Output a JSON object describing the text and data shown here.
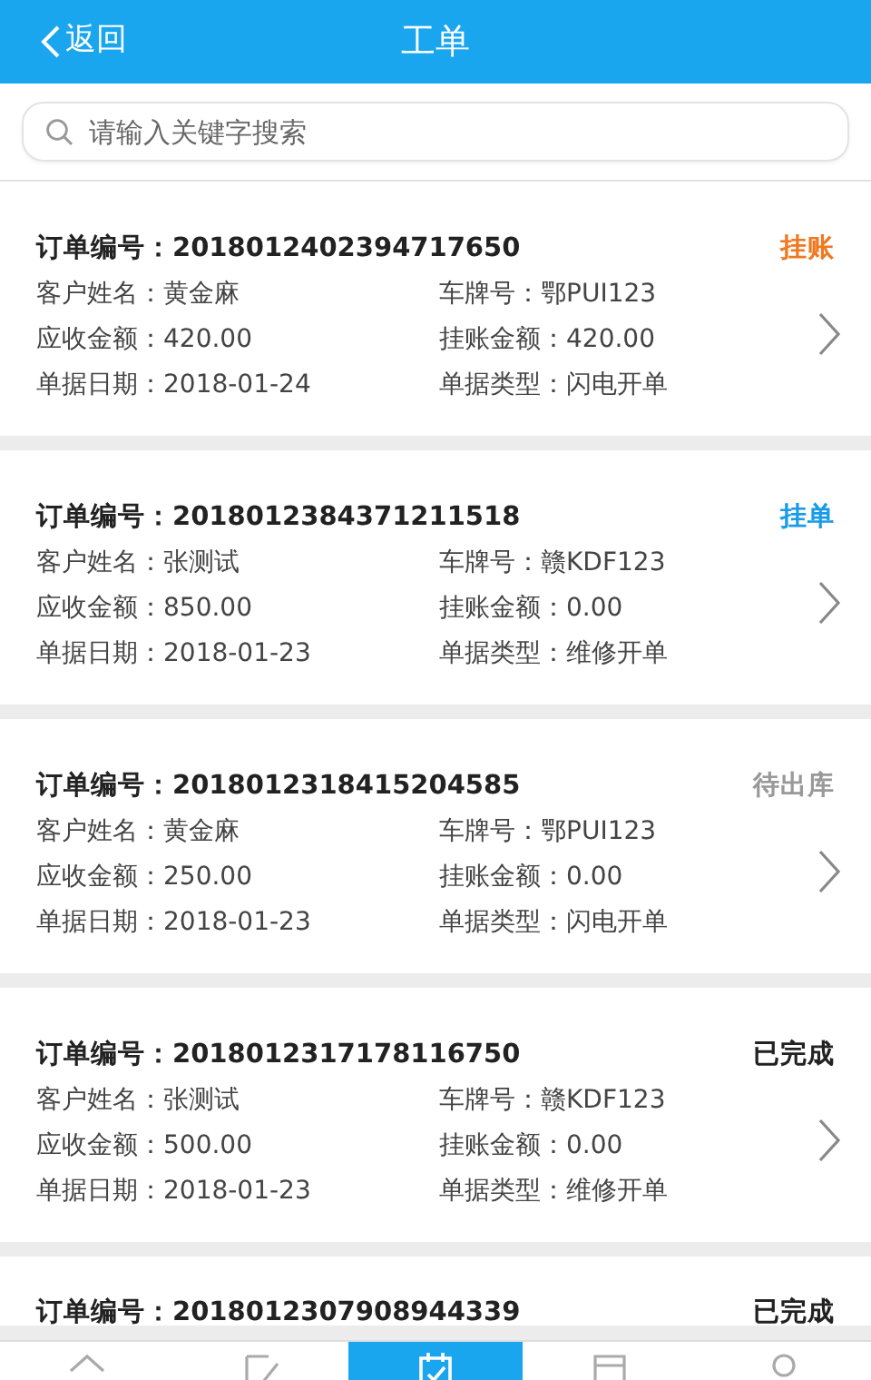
{
  "header": {
    "back": "返回",
    "title": "工单"
  },
  "search": {
    "placeholder": "请输入关键字搜索"
  },
  "orders": [
    {
      "title": "订单编号：2018012402394717650",
      "status": "挂账",
      "color": "#f07820",
      "rows": [
        {
          "left": "客户姓名：黄金麻",
          "right": "车牌号：鄂PUI123"
        },
        {
          "left": "应收金额：420.00",
          "right": "挂账金额：420.00"
        },
        {
          "left": "单据日期：2018-01-24",
          "right": "单据类型：闪电开单"
        }
      ]
    },
    {
      "title": "订单编号：2018012384371211518",
      "status": "挂单",
      "color": "#1a9be8",
      "rows": [
        {
          "left": "客户姓名：张测试",
          "right": "车牌号：赣KDF123"
        },
        {
          "left": "应收金额：850.00",
          "right": "挂账金额：0.00"
        },
        {
          "left": "单据日期：2018-01-23",
          "right": "单据类型：维修开单"
        }
      ]
    },
    {
      "title": "订单编号：2018012318415204585",
      "status": "待出库",
      "color": "#999999",
      "rows": [
        {
          "left": "客户姓名：黄金麻",
          "right": "车牌号：鄂PUI123"
        },
        {
          "left": "应收金额：250.00",
          "right": "挂账金额：0.00"
        },
        {
          "left": "单据日期：2018-01-23",
          "right": "单据类型：闪电开单"
        }
      ]
    },
    {
      "title": "订单编号：2018012317178116750",
      "status": "已完成",
      "color": "#222222",
      "rows": [
        {
          "left": "客户姓名：张测试",
          "right": "车牌号：赣KDF123"
        },
        {
          "left": "应收金额：500.00",
          "right": "挂账金额：0.00"
        },
        {
          "left": "单据日期：2018-01-23",
          "right": "单据类型：维修开单"
        }
      ]
    },
    {
      "title": "订单编号：2018012307908944339",
      "status": "已完成",
      "color": "#222222"
    }
  ],
  "tabbar": [
    {
      "selected": false
    },
    {
      "selected": false
    },
    {
      "selected": true
    },
    {
      "selected": false
    },
    {
      "selected": false
    }
  ]
}
